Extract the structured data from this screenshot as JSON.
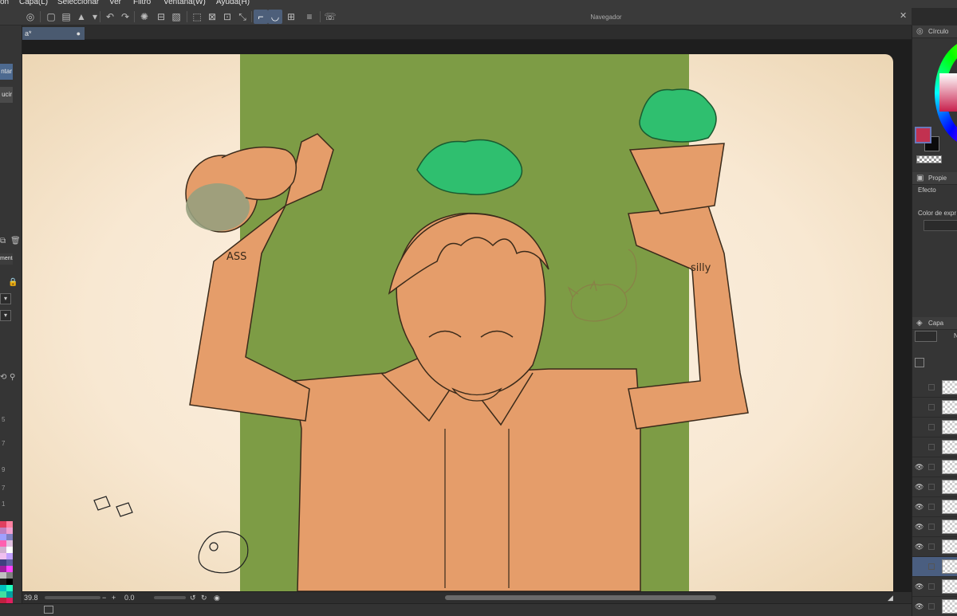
{
  "menubar": {
    "items": [
      {
        "label": "ón"
      },
      {
        "label": "Capa(L)"
      },
      {
        "label": "Seleccionar"
      },
      {
        "label": "Ver"
      },
      {
        "label": "Filtro"
      },
      {
        "label": "Ventana(W)"
      },
      {
        "label": "Ayuda(H)"
      }
    ]
  },
  "navigator": {
    "title": "Navegador"
  },
  "document_tab": {
    "label": "a*",
    "modified_marker": "●"
  },
  "left_panel": {
    "button_1": "ntar",
    "button_2": "ucir",
    "tab_label": "mentar",
    "numbers": [
      "5",
      "7",
      "9",
      "7",
      "1"
    ]
  },
  "status": {
    "zoom": "39.8",
    "minus": "−",
    "plus": "+",
    "angle": "0.0",
    "separator": "◢"
  },
  "right_panel": {
    "color_panel_title": "Círculo",
    "properties_title": "Propie",
    "effect_label": "Efecto",
    "expression_color_label": "Color de expr",
    "layer_panel_title": "Capa",
    "layer_blend_short": "N"
  },
  "canvas_text": {
    "tattoo_left": "ASS",
    "tattoo_right": "silly"
  },
  "colors": {
    "foreground": "#c23150",
    "background": "#0b0b0b",
    "skin": "#e59d6a",
    "backdrop": "#7d9c45",
    "plant": "#2fbf6f",
    "paper": "#f8e8d2"
  },
  "palette": [
    "#e04060",
    "#ff80a0",
    "#c080c0",
    "#f0a0d0",
    "#a0a0ff",
    "#8080c0",
    "#ff60b0",
    "#e0c0e0",
    "#d0b0d0",
    "#ffffff",
    "#f0c0f0",
    "#c0a0ff",
    "#404080",
    "#6060a0",
    "#a020a0",
    "#ff40ff",
    "#c0c0c0",
    "#808080",
    "#202020",
    "#000000",
    "#00c0c0",
    "#20ffc0",
    "#40e0a0",
    "#00a0a0",
    "#c02040",
    "#e02060",
    "#8000a0",
    "#a040c0"
  ],
  "layers": [
    {
      "visible": false
    },
    {
      "visible": false
    },
    {
      "visible": false
    },
    {
      "visible": false
    },
    {
      "visible": true
    },
    {
      "visible": true
    },
    {
      "visible": true
    },
    {
      "visible": true
    },
    {
      "visible": true
    },
    {
      "visible": false
    },
    {
      "visible": true
    },
    {
      "visible": true
    }
  ]
}
